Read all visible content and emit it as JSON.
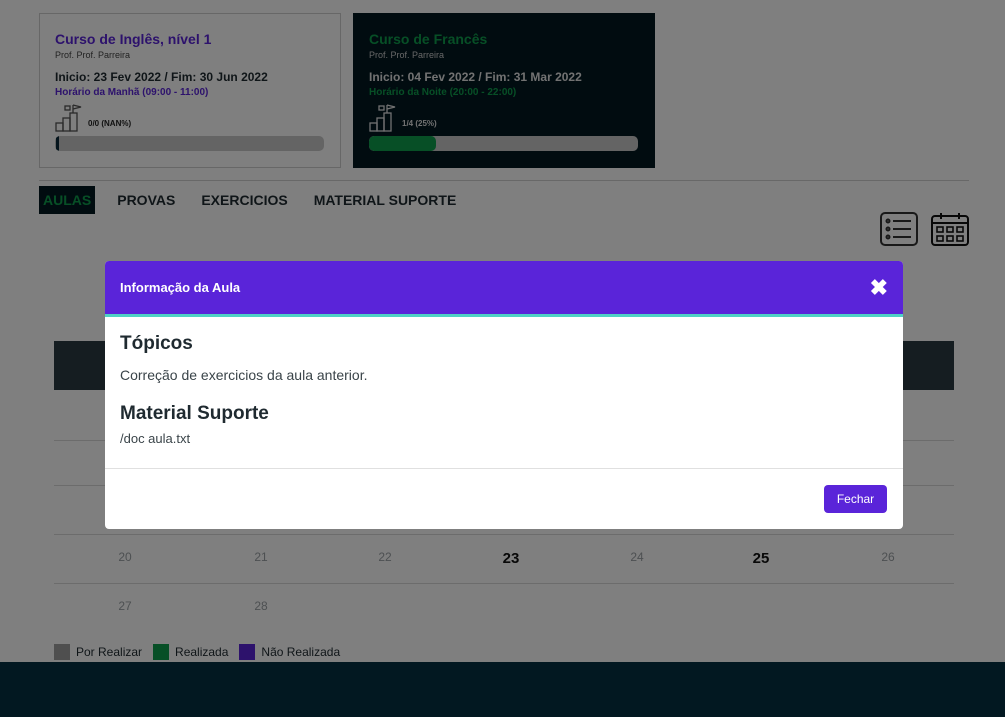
{
  "courses": [
    {
      "title": "Curso de Inglês, nível 1",
      "professor": "Prof. Prof. Parreira",
      "dates": "Inicio: 23 Fev 2022 / Fim: 30 Jun 2022",
      "schedule": "Horário da Manhã (09:00 - 11:00)",
      "progress_label": "0/0 (NAN%)",
      "progress_fraction": 0
    },
    {
      "title": "Curso de Francês",
      "professor": "Prof. Prof. Parreira",
      "dates": "Inicio: 04 Fev 2022 / Fim: 31 Mar 2022",
      "schedule": "Horário da Noite (20:00 - 22:00)",
      "progress_label": "1/4 (25%)",
      "progress_fraction": 0.25
    }
  ],
  "tabs": [
    {
      "label": "AULAS",
      "active": true
    },
    {
      "label": "PROVAS",
      "active": false
    },
    {
      "label": "EXERCICIOS",
      "active": false
    },
    {
      "label": "MATERIAL SUPORTE",
      "active": false
    }
  ],
  "calendar": {
    "week_row_a": [
      "20",
      "21",
      "22",
      "23",
      "24",
      "25",
      "26"
    ],
    "week_row_b": [
      "27",
      "28"
    ]
  },
  "legend": [
    {
      "label": "Por Realizar",
      "color": "#9e9e9e"
    },
    {
      "label": "Realizada",
      "color": "#0e9f4c"
    },
    {
      "label": "Não Realizada",
      "color": "#5a24d9"
    }
  ],
  "modal": {
    "title": "Informação da Aula",
    "close_glyph": "✖",
    "topics_heading": "Tópicos",
    "topics_text": "Correção de exercicios da aula anterior.",
    "material_heading": "Material Suporte",
    "material_text": "/doc aula.txt",
    "close_button": "Fechar"
  },
  "colors": {
    "accent": "#5a24d9",
    "success": "#0e9f4c",
    "dark": "#021821"
  }
}
